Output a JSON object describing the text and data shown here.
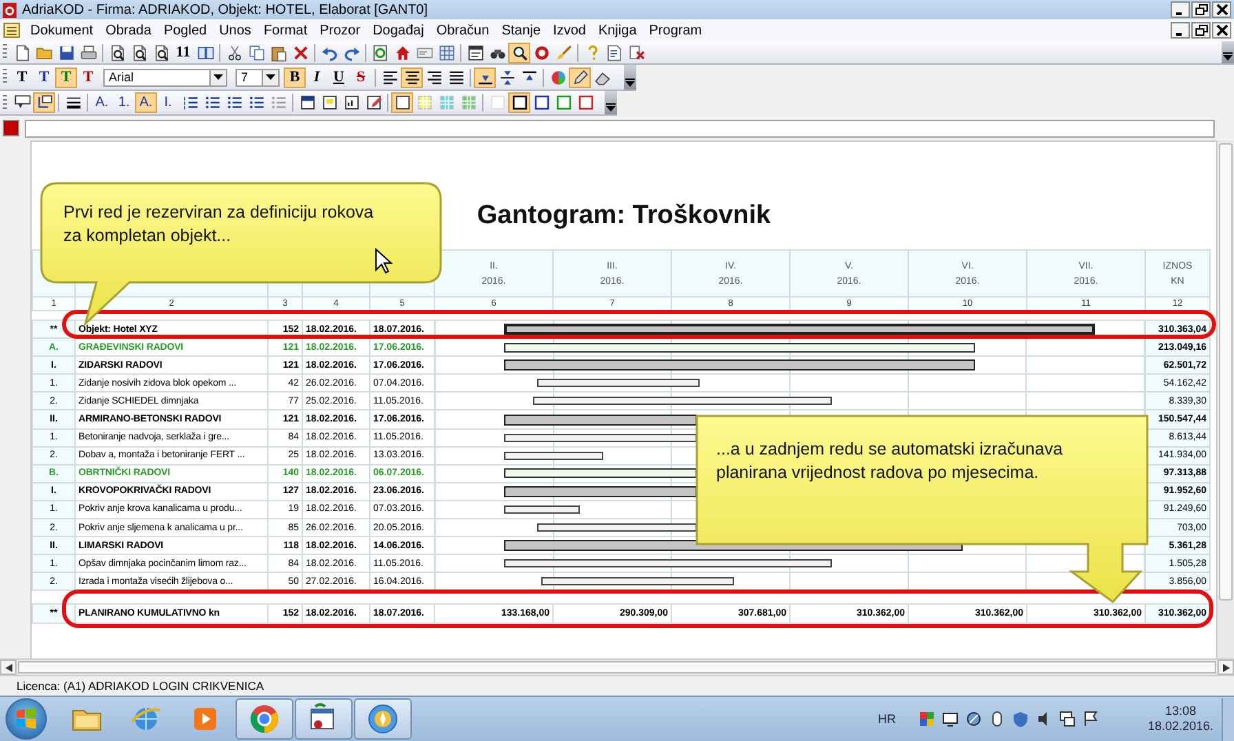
{
  "window": {
    "title": "AdriaKOD - Firma: ADRIAKOD,   Objekt: HOTEL,  Elaborat [GANT0]"
  },
  "menu": [
    "Dokument",
    "Obrada",
    "Pogled",
    "Unos",
    "Format",
    "Prozor",
    "Događaj",
    "Obračun",
    "Stanje",
    "Izvod",
    "Knjiga",
    "Program"
  ],
  "toolbars": [
    {
      "items": [
        {
          "kind": "icon",
          "pressed": false
        },
        {
          "kind": "icon",
          "pressed": false
        },
        {
          "kind": "icon",
          "pressed": false
        },
        {
          "kind": "icon",
          "pressed": false
        },
        {
          "kind": "separator"
        },
        {
          "kind": "icon",
          "pressed": false
        },
        {
          "kind": "icon",
          "pressed": false
        },
        {
          "kind": "icon",
          "pressed": false
        },
        {
          "kind": "text",
          "label": "11",
          "pressed": false
        },
        {
          "kind": "icon",
          "pressed": false
        },
        {
          "kind": "separator"
        },
        {
          "kind": "icon",
          "pressed": false
        },
        {
          "kind": "icon",
          "pressed": false
        },
        {
          "kind": "icon",
          "pressed": false
        },
        {
          "kind": "icon",
          "pressed": false
        },
        {
          "kind": "separator"
        },
        {
          "kind": "icon",
          "pressed": false
        },
        {
          "kind": "icon",
          "pressed": false
        },
        {
          "kind": "separator"
        },
        {
          "kind": "icon",
          "pressed": false
        },
        {
          "kind": "icon",
          "pressed": false
        },
        {
          "kind": "icon",
          "pressed": false
        },
        {
          "kind": "icon",
          "pressed": false
        },
        {
          "kind": "separator"
        },
        {
          "kind": "icon",
          "pressed": false
        },
        {
          "kind": "icon",
          "pressed": false
        },
        {
          "kind": "icon",
          "pressed": true
        },
        {
          "kind": "icon",
          "pressed": false
        },
        {
          "kind": "icon",
          "pressed": false
        },
        {
          "kind": "separator"
        },
        {
          "kind": "icon",
          "pressed": false
        },
        {
          "kind": "icon",
          "pressed": false
        },
        {
          "kind": "icon",
          "pressed": false
        }
      ]
    },
    {
      "items": [
        {
          "kind": "text",
          "label": "T",
          "pressed": false
        },
        {
          "kind": "text",
          "label": "T",
          "pressed": false
        },
        {
          "kind": "text",
          "label": "T",
          "pressed": true
        },
        {
          "kind": "text",
          "label": "T",
          "pressed": false
        },
        {
          "kind": "combo",
          "value": "Arial"
        },
        {
          "kind": "combo",
          "value": "7"
        },
        {
          "kind": "text",
          "label": "B",
          "pressed": true
        },
        {
          "kind": "text",
          "label": "I",
          "pressed": false
        },
        {
          "kind": "text",
          "label": "U",
          "pressed": false
        },
        {
          "kind": "text",
          "label": "S",
          "pressed": false
        },
        {
          "kind": "separator"
        },
        {
          "kind": "icon",
          "pressed": false
        },
        {
          "kind": "icon",
          "pressed": true
        },
        {
          "kind": "icon",
          "pressed": false
        },
        {
          "kind": "icon",
          "pressed": false
        },
        {
          "kind": "separator"
        },
        {
          "kind": "icon",
          "pressed": true
        },
        {
          "kind": "icon",
          "pressed": false
        },
        {
          "kind": "icon",
          "pressed": false
        },
        {
          "kind": "separator"
        },
        {
          "kind": "icon",
          "pressed": false
        },
        {
          "kind": "icon",
          "pressed": true
        },
        {
          "kind": "icon",
          "pressed": false
        }
      ]
    },
    {
      "items": [
        {
          "kind": "icon",
          "pressed": false
        },
        {
          "kind": "icon",
          "pressed": true
        },
        {
          "kind": "separator"
        },
        {
          "kind": "icon",
          "pressed": false
        },
        {
          "kind": "separator"
        },
        {
          "kind": "text",
          "label": "A.",
          "pressed": false
        },
        {
          "kind": "text",
          "label": "1.",
          "pressed": false
        },
        {
          "kind": "text",
          "label": "A.",
          "pressed": true
        },
        {
          "kind": "text",
          "label": "I.",
          "pressed": false
        },
        {
          "kind": "icon",
          "pressed": false
        },
        {
          "kind": "icon",
          "pressed": false
        },
        {
          "kind": "icon",
          "pressed": false
        },
        {
          "kind": "icon",
          "pressed": false
        },
        {
          "kind": "icon",
          "pressed": false
        },
        {
          "kind": "separator"
        },
        {
          "kind": "icon",
          "pressed": false
        },
        {
          "kind": "icon",
          "pressed": false
        },
        {
          "kind": "icon",
          "pressed": false
        },
        {
          "kind": "icon",
          "pressed": false
        },
        {
          "kind": "separator"
        },
        {
          "kind": "icon",
          "pressed": true
        },
        {
          "kind": "icon",
          "pressed": false
        },
        {
          "kind": "icon",
          "pressed": false
        },
        {
          "kind": "icon",
          "pressed": false
        },
        {
          "kind": "separator"
        },
        {
          "kind": "icon",
          "pressed": false
        },
        {
          "kind": "icon",
          "pressed": true
        },
        {
          "kind": "icon",
          "pressed": false
        },
        {
          "kind": "icon",
          "pressed": false
        },
        {
          "kind": "icon",
          "pressed": false
        }
      ]
    }
  ],
  "document": {
    "title": "Gantogram: Troškovnik",
    "months": [
      {
        "month": "II.",
        "year": "2016."
      },
      {
        "month": "III.",
        "year": "2016."
      },
      {
        "month": "IV.",
        "year": "2016."
      },
      {
        "month": "V.",
        "year": "2016."
      },
      {
        "month": "VI.",
        "year": "2016."
      },
      {
        "month": "VII.",
        "year": "2016."
      }
    ],
    "amount_header": [
      "IZNOS",
      "KN"
    ],
    "column_numbers": [
      "1",
      "2",
      "3",
      "4",
      "5",
      "6",
      "7",
      "8",
      "9",
      "10",
      "11",
      "12"
    ],
    "rows": [
      {
        "kind": "object",
        "num": "**",
        "name": "Objekt: Hotel XYZ",
        "days": "152",
        "start": "18.02.2016.",
        "end": "18.07.2016.",
        "amount": "310.363,04"
      },
      {
        "kind": "group",
        "num": "A.",
        "name": "GRAĐEVINSKI RADOVI",
        "days": "121",
        "start": "18.02.2016.",
        "end": "17.06.2016.",
        "amount": "213.049,16"
      },
      {
        "kind": "section",
        "num": "I.",
        "name": "ZIDARSKI RADOVI",
        "days": "121",
        "start": "18.02.2016.",
        "end": "17.06.2016.",
        "amount": "62.501,72"
      },
      {
        "kind": "item",
        "num": "1.",
        "name": "Zidanje nosivih zidova blok opekom ...",
        "days": "42",
        "start": "26.02.2016.",
        "end": "07.04.2016.",
        "amount": "54.162,42"
      },
      {
        "kind": "item",
        "num": "2.",
        "name": "Zidanje SCHIEDEL dimnjaka",
        "days": "77",
        "start": "25.02.2016.",
        "end": "11.05.2016.",
        "amount": "8.339,30"
      },
      {
        "kind": "section",
        "num": "II.",
        "name": "ARMIRANO-BETONSKI RADOVI",
        "days": "121",
        "start": "18.02.2016.",
        "end": "17.06.2016.",
        "amount": "150.547,44"
      },
      {
        "kind": "item",
        "num": "1.",
        "name": "Betoniranje nadvoja, serklaža i gre...",
        "days": "84",
        "start": "18.02.2016.",
        "end": "11.05.2016.",
        "amount": "8.613,44"
      },
      {
        "kind": "item",
        "num": "2.",
        "name": "Dobav a, montaža i betoniranje FERT ...",
        "days": "25",
        "start": "18.02.2016.",
        "end": "13.03.2016.",
        "amount": "141.934,00"
      },
      {
        "kind": "group",
        "num": "B.",
        "name": "OBRTNIČKI RADOVI",
        "days": "140",
        "start": "18.02.2016.",
        "end": "06.07.2016.",
        "amount": "97.313,88"
      },
      {
        "kind": "section",
        "num": "I.",
        "name": "KROVOPOKRIVAČKI RADOVI",
        "days": "127",
        "start": "18.02.2016.",
        "end": "23.06.2016.",
        "amount": "91.952,60"
      },
      {
        "kind": "item",
        "num": "1.",
        "name": "Pokriv anje krova kanalicama u produ...",
        "days": "19",
        "start": "18.02.2016.",
        "end": "07.03.2016.",
        "amount": "91.249,60"
      },
      {
        "kind": "item",
        "num": "2.",
        "name": "Pokriv anje sljemena k analicama u pr...",
        "days": "85",
        "start": "26.02.2016.",
        "end": "20.05.2016.",
        "amount": "703,00"
      },
      {
        "kind": "section",
        "num": "II.",
        "name": "LIMARSKI RADOVI",
        "days": "118",
        "start": "18.02.2016.",
        "end": "14.06.2016.",
        "amount": "5.361,28"
      },
      {
        "kind": "item",
        "num": "1.",
        "name": "Opšav  dimnjaka pocinčanim limom raz...",
        "days": "84",
        "start": "18.02.2016.",
        "end": "11.05.2016.",
        "amount": "1.505,28"
      },
      {
        "kind": "item",
        "num": "2.",
        "name": "Izrada i montaža visećih žlijebova o...",
        "days": "50",
        "start": "27.02.2016.",
        "end": "16.04.2016.",
        "amount": "3.856,00"
      }
    ],
    "total": {
      "num": "**",
      "name": "PLANIRANO KUMULATIVNO kn",
      "days": "152",
      "start": "18.02.2016.",
      "end": "18.07.2016.",
      "months": [
        "133.168,00",
        "290.309,00",
        "307.681,00",
        "310.362,00",
        "310.362,00",
        "310.362,00"
      ],
      "amount": "310.362,00"
    }
  },
  "annotations": [
    {
      "kind": "outline"
    },
    {
      "kind": "outline"
    },
    {
      "kind": "callout",
      "text": "Prvi red je rezerviran za definiciju rokova za kompletan objekt..."
    },
    {
      "kind": "arrow-callout",
      "text": "...a u zadnjem redu se automatski izračunava planirana vrijednost radova po mjesecima."
    }
  ],
  "status_bar": {
    "license": "Licenca:  (A1) ADRIAKOD LOGIN CRIKVENICA"
  },
  "taskbar": {
    "apps": [
      {
        "running": false
      },
      {
        "running": false
      },
      {
        "running": false
      },
      {
        "running": true
      },
      {
        "running": true
      },
      {
        "running": true
      }
    ],
    "language": "HR",
    "time": "13:08",
    "date": "18.02.2016."
  }
}
